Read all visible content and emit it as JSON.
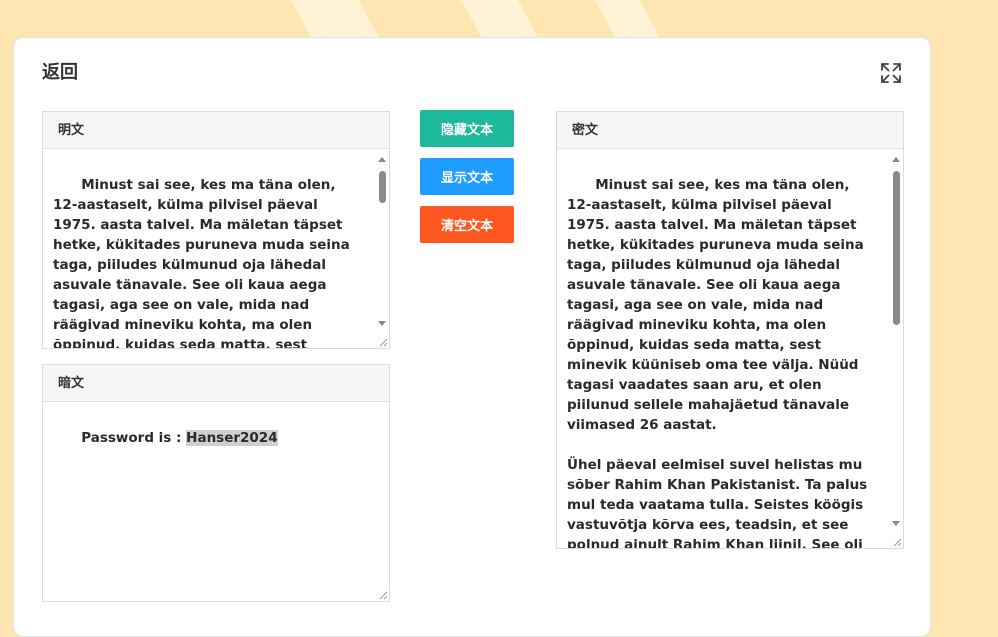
{
  "header": {
    "back_label": "返回"
  },
  "icons": {
    "expand": "expand-icon"
  },
  "plaintext": {
    "label": "明文",
    "value": "Minust sai see, kes ma täna olen, 12-aastaselt, külma pilvisel päeval 1975. aasta talvel. Ma mäletan täpset hetke, kükitades puruneva muda seina taga, piiludes külmunud oja lähedal asuvale tänavale. See oli kaua aega tagasi, aga see on vale, mida nad räägivad mineviku kohta, ma olen õppinud, kuidas seda matta, sest minevik küüniseb oma tee välja. Nüüd tagasi vaadates saan aru, et olen piilunud sellele"
  },
  "hidden": {
    "label": "暗文",
    "prefix": "Password is : ",
    "highlight": "Hanser2024"
  },
  "buttons": {
    "hide": "隐藏文本",
    "show": "显示文本",
    "clear": "清空文本"
  },
  "ciphertext": {
    "label": "密文",
    "value": "Minust sai see, kes ma täna olen, 12-aastaselt, külma pilvisel päeval 1975. aasta talvel. Ma mäletan täpset hetke, kükitades puruneva muda seina taga, piiludes külmunud oja lähedal asuvale tänavale. See oli kaua aega tagasi, aga see on vale, mida nad räägivad mineviku kohta, ma olen õppinud, kuidas seda matta, sest minevik küüniseb oma tee välja. Nüüd tagasi vaadates saan aru, et olen piilunud sellele mahajäetud tänavale viimased 26 aastat.\n\nÜhel päeval eelmisel suvel helistas mu sõber Rahim Khan Pakistanist. Ta palus mul teda vaatama tulla. Seistes köögis vastuvõtja kõrva ees, teadsin, et see polnud ainult Rahim Khan liinil. See oli mu toonitamata pattude minevik. Pärast toru katkestamist läksin jalutama mööda Spreckelsi järve Golden Gate Parki põhjaserva"
  },
  "colors": {
    "hide_button": "#1cb99b",
    "show_button": "#1f9cff",
    "clear_button": "#ff5722",
    "background": "#fde6b2"
  }
}
